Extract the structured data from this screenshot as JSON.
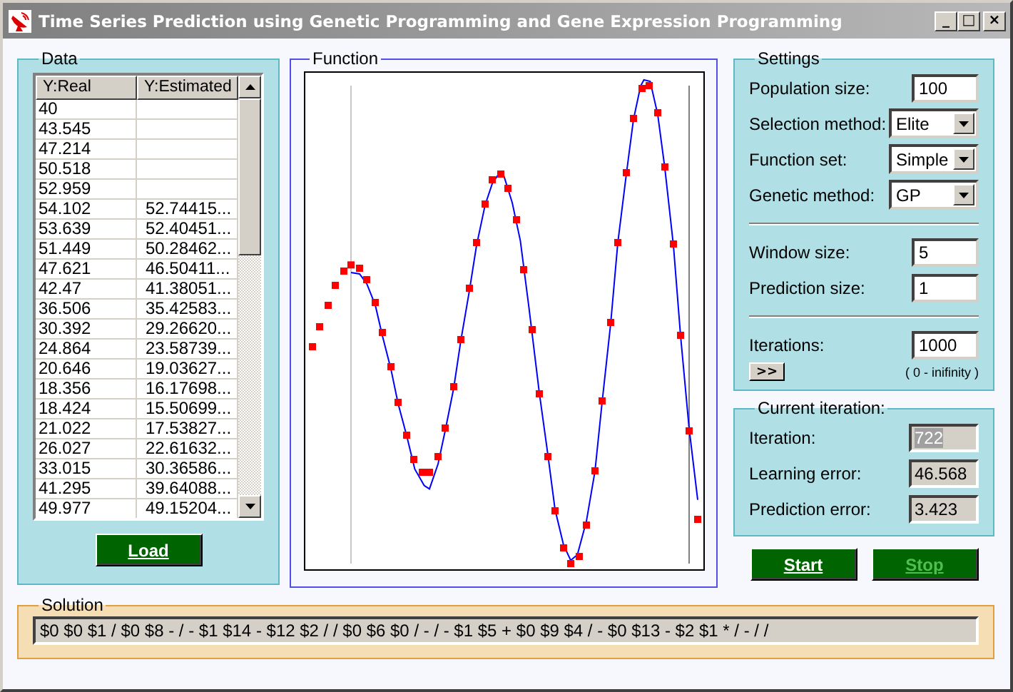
{
  "window": {
    "title": "Time Series Prediction using Genetic Programming and Gene Expression Programming",
    "controls": [
      "_",
      "□",
      "×"
    ]
  },
  "data_panel": {
    "title": "Data",
    "columns": [
      "Y:Real",
      "Y:Estimated"
    ],
    "rows": [
      [
        "40",
        ""
      ],
      [
        "43.545",
        ""
      ],
      [
        "47.214",
        ""
      ],
      [
        "50.518",
        ""
      ],
      [
        "52.959",
        ""
      ],
      [
        "54.102",
        "52.74415..."
      ],
      [
        "53.639",
        "52.40451..."
      ],
      [
        "51.449",
        "50.28462..."
      ],
      [
        "47.621",
        "46.50411..."
      ],
      [
        "42.47",
        "41.38051..."
      ],
      [
        "36.506",
        "35.42583..."
      ],
      [
        "30.392",
        "29.26620..."
      ],
      [
        "24.864",
        "23.58739..."
      ],
      [
        "20.646",
        "19.03627..."
      ],
      [
        "18.356",
        "16.17698..."
      ],
      [
        "18.424",
        "15.50699..."
      ],
      [
        "21.022",
        "17.53827..."
      ],
      [
        "26.027",
        "22.61632..."
      ],
      [
        "33.015",
        "30.36586..."
      ],
      [
        "41.295",
        "39.64088..."
      ],
      [
        "49.977",
        "49.15204..."
      ]
    ],
    "load_button": "Load"
  },
  "function_panel": {
    "title": "Function"
  },
  "settings": {
    "title": "Settings",
    "fields": [
      {
        "kind": "text",
        "label": "Population size:",
        "value": "100"
      },
      {
        "kind": "combo",
        "label": "Selection method:",
        "value": "Elite"
      },
      {
        "kind": "combo",
        "label": "Function set:",
        "value": "Simple"
      },
      {
        "kind": "combo",
        "label": "Genetic method:",
        "value": "GP"
      },
      {
        "kind": "divider"
      },
      {
        "kind": "text",
        "label": "Window size:",
        "value": "5"
      },
      {
        "kind": "text",
        "label": "Prediction size:",
        "value": "1"
      },
      {
        "kind": "divider"
      },
      {
        "kind": "text",
        "label": "Iterations:",
        "value": "1000"
      }
    ],
    "more_button": ">>",
    "iterations_hint": "( 0 - inifinity )"
  },
  "current_iteration": {
    "title": "Current iteration:",
    "fields": [
      {
        "label": "Iteration:",
        "value": "722",
        "highlighted": true
      },
      {
        "label": "Learning error:",
        "value": "46.568",
        "highlighted": false
      },
      {
        "label": "Prediction error:",
        "value": "3.423",
        "highlighted": false
      }
    ]
  },
  "buttons": [
    {
      "label": "Start",
      "disabled": false
    },
    {
      "label": "Stop",
      "disabled": true
    }
  ],
  "solution": {
    "title": "Solution",
    "value": "$0 $0 $1 / $0 $8 - / - $1 $14 - $12 $2 / / $0 $6 $0 / - / - $1 $5 + $0 $9 $4 / - $0 $13 - $2 $1 * / - / /"
  }
}
